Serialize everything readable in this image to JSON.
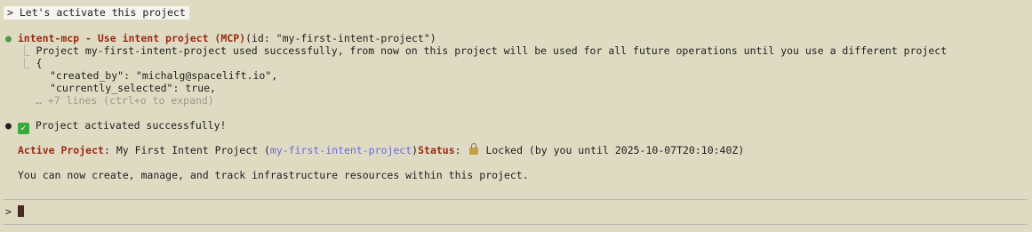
{
  "user_message": "> Let's activate this project",
  "tool_call": {
    "bullet": "●",
    "name": "intent-mcp - Use intent project (MCP)",
    "args": "(id: \"my-first-intent-project\")",
    "branch": "⎿",
    "result_line": "Project my-first-intent-project used successfully, from now on this project will be used for all future operations until you use a different project",
    "json_open": "{",
    "json_lines": [
      "\"created_by\": \"michalg@spacelift.io\",",
      "\"currently_selected\": true,"
    ],
    "collapsed": "… +7 lines (ctrl+o to expand)"
  },
  "response": {
    "bullet": "●",
    "check_icon": "check-mark-icon",
    "check_glyph": "✓",
    "activated_text": "Project activated successfully!",
    "active_label": "Active Project",
    "active_sep": ":",
    "project_name": "My First Intent Project (",
    "project_id": "my-first-intent-project",
    "close_paren": ")",
    "status_label": "Status",
    "status_sep": ":",
    "lock_icon": "lock-icon",
    "status_value": "Locked (by you until 2025-10-07T20:10:40Z)",
    "closing_text": "You can now create, manage, and track infrastructure resources within this project."
  },
  "prompt": {
    "symbol": ">"
  },
  "colors": {
    "background": "#dfdbc3",
    "accent_red": "#9a2a12",
    "link_blue": "#6a6ae0",
    "bullet_green": "#4a9a4a"
  }
}
